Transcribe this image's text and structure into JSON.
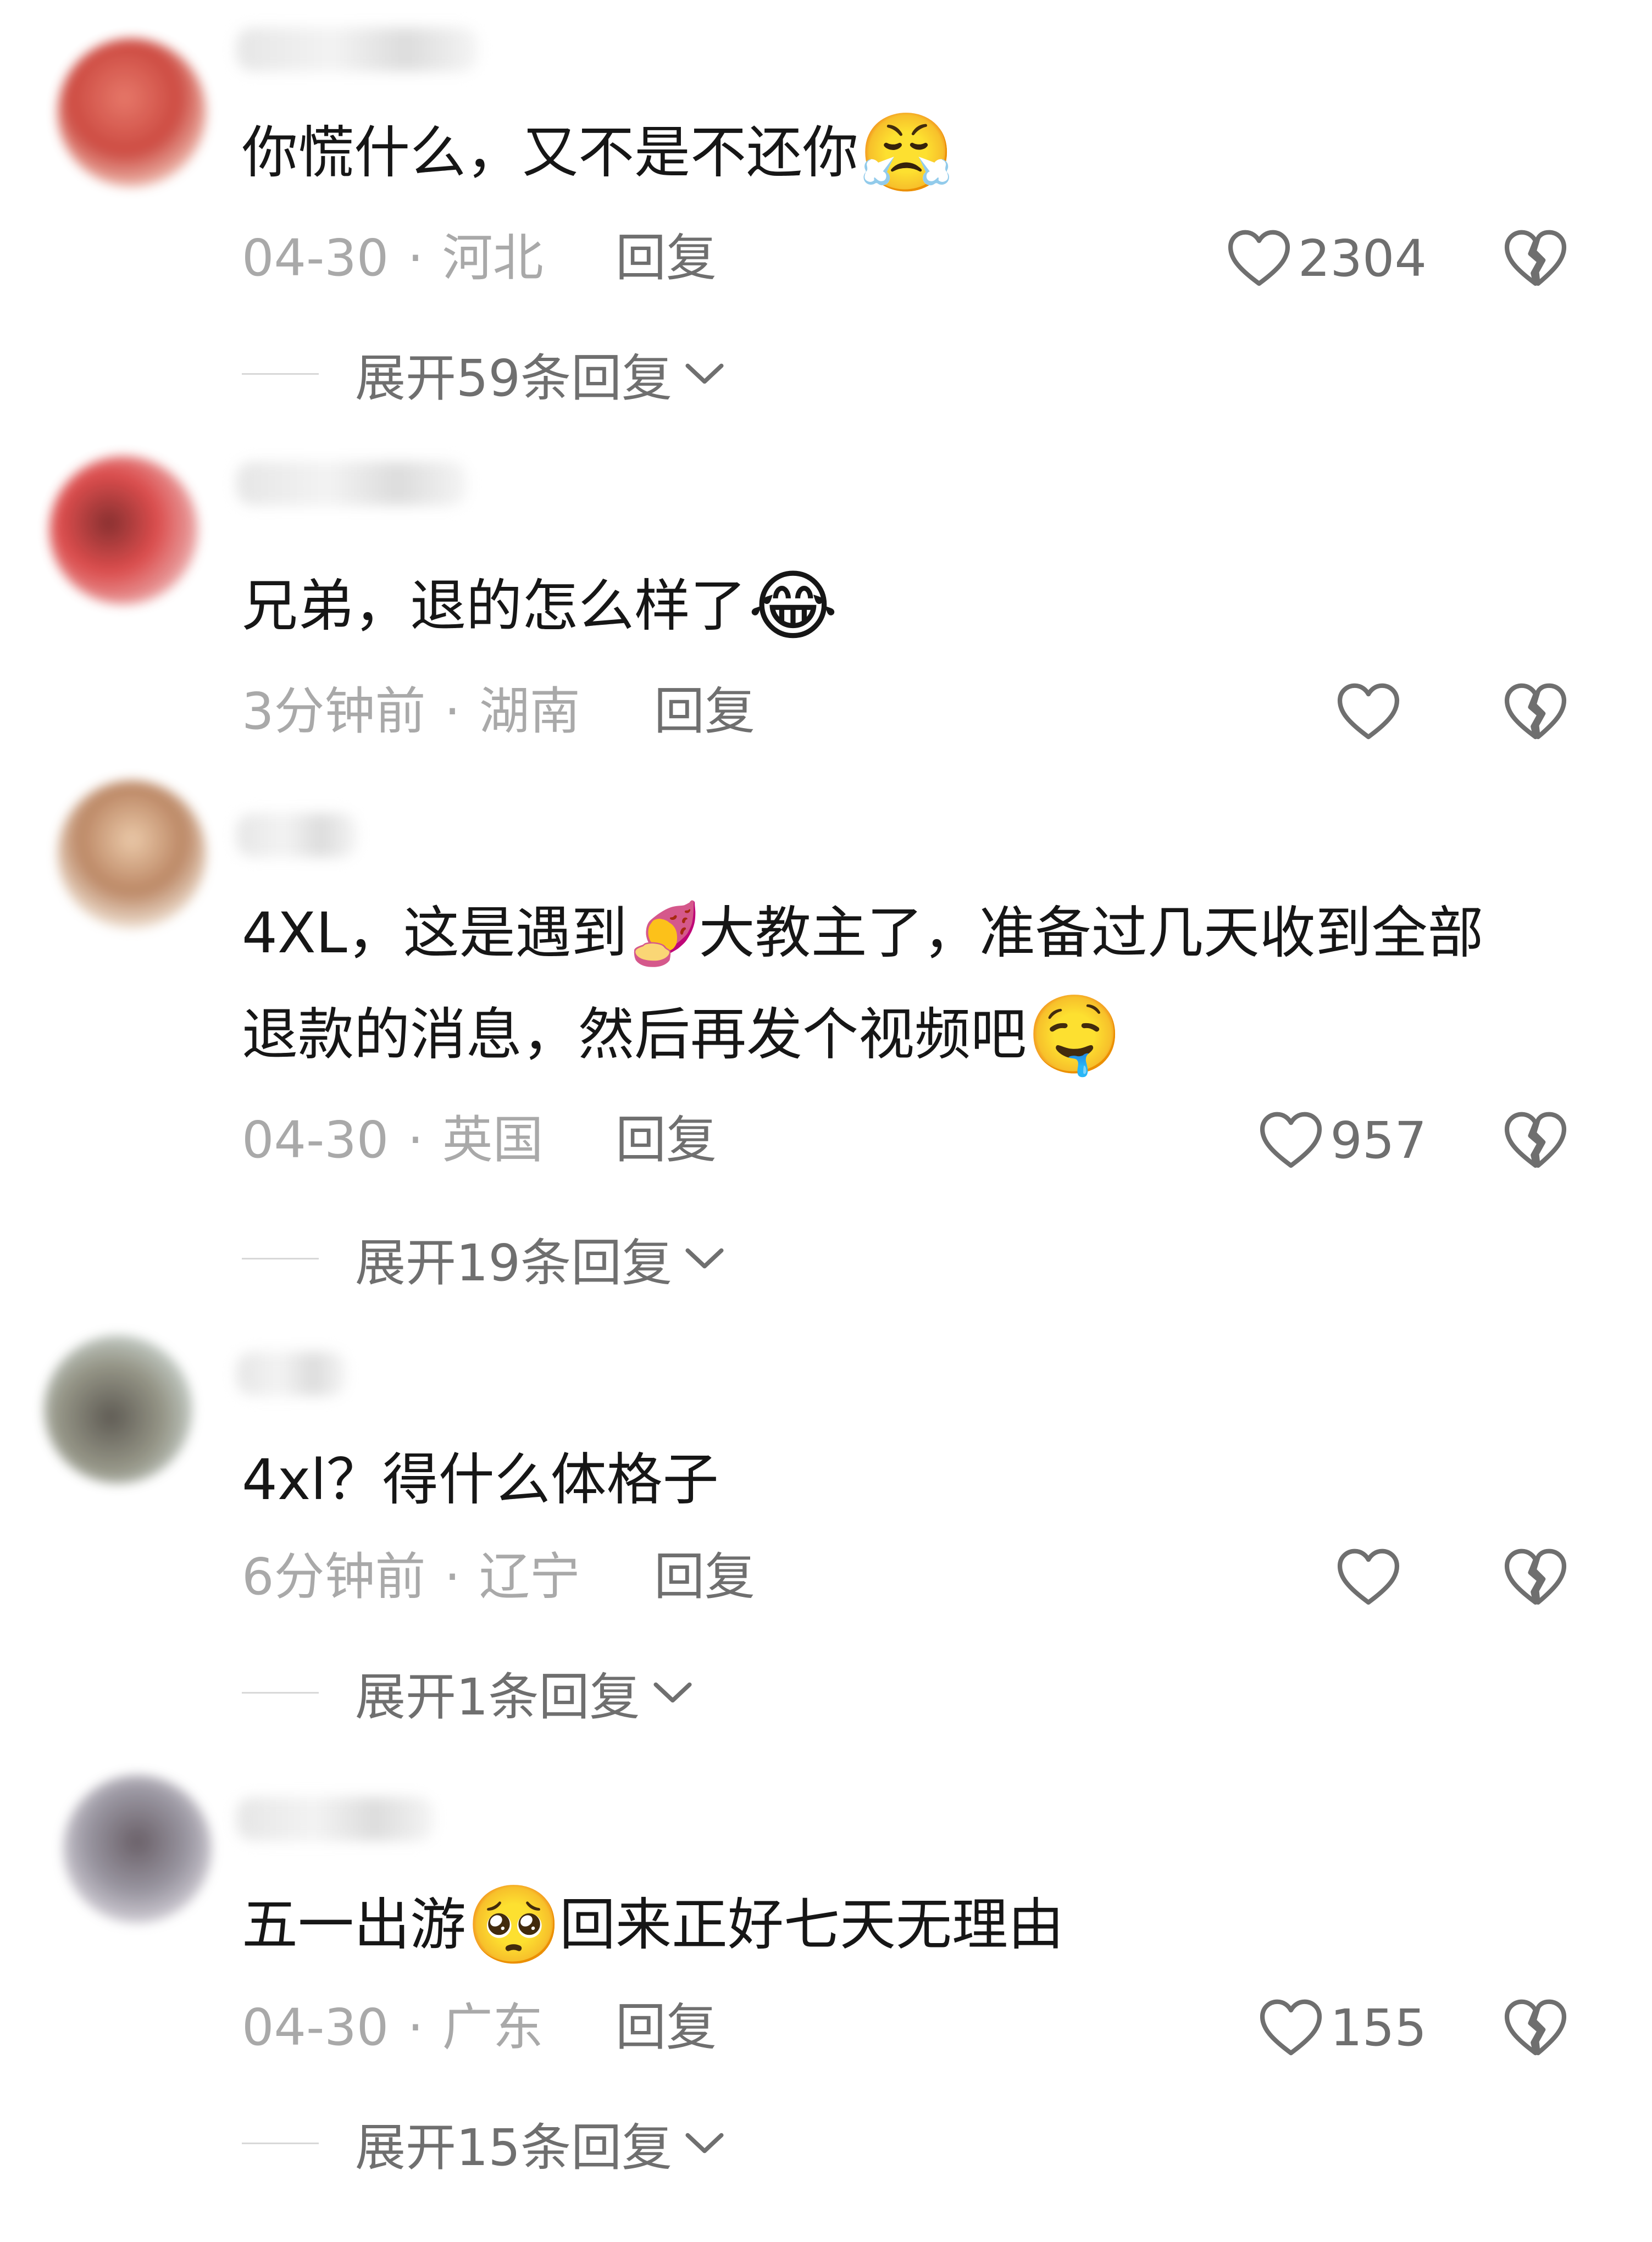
{
  "comments": [
    {
      "text": "你慌什么，又不是不还你",
      "emoji_after": "😤",
      "date": "04-30",
      "location": "河北",
      "reply_label": "回复",
      "likes": "2304",
      "expand_label": "展开59条回复"
    },
    {
      "text": "兄弟，退的怎么样了",
      "emoji_after": "😂",
      "date": "3分钟前",
      "location": "湖南",
      "reply_label": "回复",
      "likes": ""
    },
    {
      "line1_a": "4XL，这是遇到",
      "emoji_mid": "🍠",
      "line1_b": "大教主了，准备过几天收到全部",
      "line2": "退款的消息，然后再发个视频吧",
      "emoji_after": "🤤",
      "date": "04-30",
      "location": "英国",
      "reply_label": "回复",
      "likes": "957",
      "expand_label": "展开19条回复"
    },
    {
      "text": "4xl？得什么体格子",
      "date": "6分钟前",
      "location": "辽宁",
      "reply_label": "回复",
      "likes": "",
      "expand_label": "展开1条回复"
    },
    {
      "text_a": "五一出游",
      "emoji_mid": "🥺",
      "text_b": "回来正好七天无理由",
      "date": "04-30",
      "location": "广东",
      "reply_label": "回复",
      "likes": "155",
      "expand_label": "展开15条回复"
    }
  ],
  "colors": {
    "text": "#161616",
    "meta": "#a9a9a9",
    "action": "#6f6f6f"
  }
}
